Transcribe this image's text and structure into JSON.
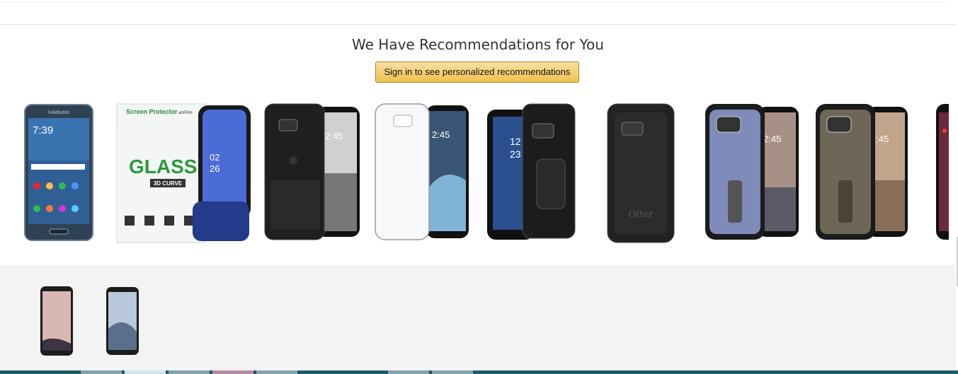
{
  "recommendations": {
    "title": "We Have Recommendations for You",
    "signin_button": "Sign in to see personalized recommendations"
  },
  "carousel": {
    "items": [
      {
        "name": "samsung-galaxy-phone",
        "brand": "SAMSUNG",
        "time": "7:39"
      },
      {
        "name": "screen-protector-glass",
        "brand_text": "Screen Protector",
        "logo": "amFilm",
        "big_text": "GLASS",
        "sub": "3D CURVE",
        "time": "02",
        "time2": "26"
      },
      {
        "name": "spigen-rugged-case",
        "time": "02:45"
      },
      {
        "name": "clear-case",
        "time": "2:45"
      },
      {
        "name": "supcase-holster-case",
        "time": "12",
        "time2": "23"
      },
      {
        "name": "otterbox-case",
        "logo": "Otter"
      },
      {
        "name": "spigen-tough-armor-blue",
        "time": "2:45"
      },
      {
        "name": "spigen-tough-armor-gunmetal",
        "time": "2:45"
      },
      {
        "name": "partial-phone-case"
      }
    ]
  },
  "bottom_thumbs": [
    {
      "name": "galaxy-s8-pink"
    },
    {
      "name": "galaxy-s8-silver"
    }
  ],
  "colors": {
    "button_top": "#f7dfa5",
    "button_bottom": "#f0c14b",
    "button_border": "#a88734",
    "bottom_bg": "#f3f3f3"
  }
}
